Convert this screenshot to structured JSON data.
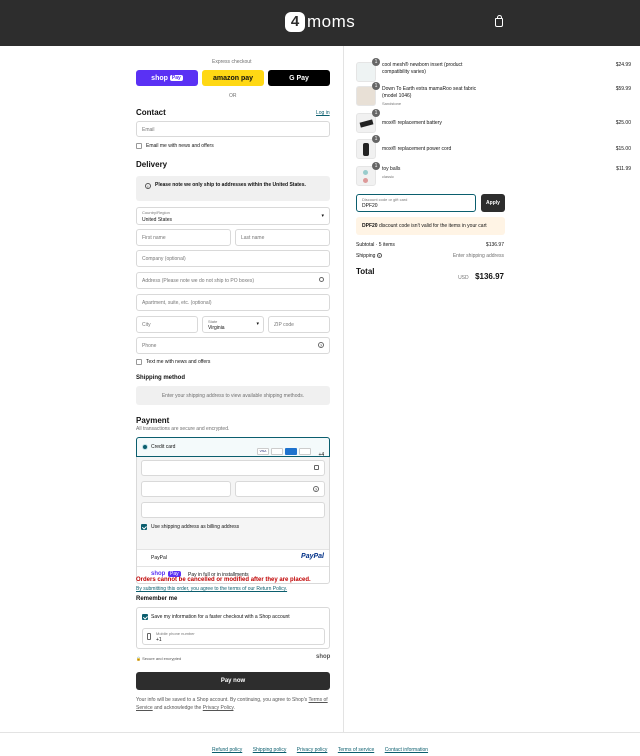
{
  "header": {
    "logo_mark": "4",
    "logo_text": "moms"
  },
  "express": {
    "title": "Express checkout",
    "shop_pay": "shop",
    "shop_pay_badge": "Pay",
    "amazon_pay": "amazon pay",
    "google_pay": "G Pay",
    "or": "OR"
  },
  "contact": {
    "title": "Contact",
    "login": "Log in",
    "email_placeholder": "Email",
    "newsletter": "Email me with news and offers"
  },
  "delivery": {
    "title": "Delivery",
    "notice": "Please note we only ship to addresses within the United States.",
    "country_label": "Country/Region",
    "country_value": "United States",
    "first_name": "First name",
    "last_name": "Last name",
    "company": "Company (optional)",
    "address": "Address (Please note we do not ship to PO boxes)",
    "apartment": "Apartment, suite, etc. (optional)",
    "city": "City",
    "state_label": "State",
    "state_value": "Virginia",
    "zip": "ZIP code",
    "phone": "Phone",
    "sms": "Text me with news and offers"
  },
  "shipping": {
    "title": "Shipping method",
    "placeholder": "Enter your shipping address to view available shipping methods."
  },
  "payment": {
    "title": "Payment",
    "subtitle": "All transactions are secure and encrypted.",
    "credit_card": "Credit card",
    "more_cards": "+4",
    "billing_same": "Use shipping address as billing address",
    "paypal": "PayPal",
    "paypal_logo": "PayPal",
    "shop_pay_label": "shop",
    "shop_pay_badge": "Pay",
    "shop_pay_text": "Pay in full or in installments"
  },
  "warning": {
    "text": "Orders cannot be cancelled or modified after they are placed.",
    "terms": "By submitting this order, you agree to the terms of our Return Policy."
  },
  "remember": {
    "title": "Remember me",
    "save_info": "Save my information for a faster checkout with a Shop account",
    "mobile_label": "Mobile phone number",
    "mobile_value": "+1",
    "secure": "Secure and encrypted",
    "shop": "shop"
  },
  "pay_now": "Pay now",
  "disclaimer": {
    "text": "Your info will be saved to a Shop account. By continuing, you agree to Shop's",
    "terms": "Terms of Service",
    "and": " and acknowledge the ",
    "privacy": "Privacy Policy",
    "end": "."
  },
  "cart": {
    "items": [
      {
        "qty": "1",
        "name": "cool mesh® newborn insert (product compatibility varies)",
        "variant": "",
        "price": "$24.99"
      },
      {
        "qty": "1",
        "name": "Down To Earth extra mamaRoo seat fabric (model 1046)",
        "variant": "Sandstone",
        "price": "$59.99"
      },
      {
        "qty": "1",
        "name": "moxi® replacement battery",
        "variant": "",
        "price": "$25.00"
      },
      {
        "qty": "1",
        "name": "moxi® replacement power cord",
        "variant": "",
        "price": "$15.00"
      },
      {
        "qty": "1",
        "name": "toy balls",
        "variant": "classic",
        "price": "$11.99"
      }
    ],
    "discount_label": "Discount code or gift card",
    "discount_value": "DPF20",
    "apply": "Apply",
    "discount_error_code": "DPF20",
    "discount_error_text": " discount code isn't valid for the items in your cart",
    "subtotal_label": "Subtotal · 5 items",
    "subtotal": "$136.97",
    "shipping_label": "Shipping",
    "shipping_value": "Enter shipping address",
    "total_label": "Total",
    "currency": "USD",
    "total": "$136.97"
  },
  "footer": {
    "links": [
      "Refund policy",
      "Shipping policy",
      "Privacy policy",
      "Terms of service",
      "Contact information"
    ]
  },
  "colors": {
    "header": "#2d2d2d",
    "accent": "#0b5e6e",
    "shop_pay": "#5a31f4",
    "amazon": "#ffd814",
    "error": "#c00000"
  }
}
